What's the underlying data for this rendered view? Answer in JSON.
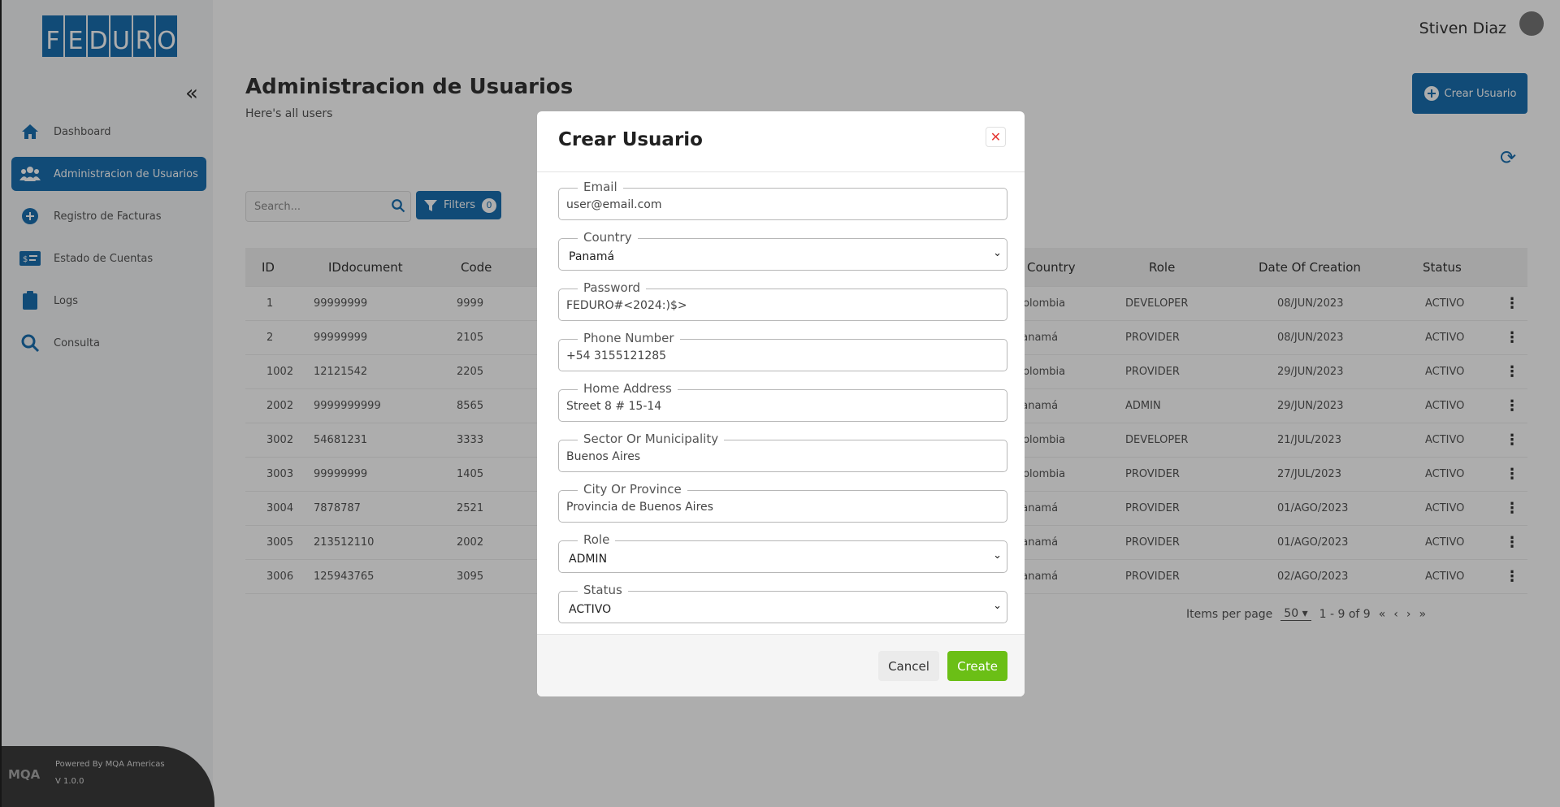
{
  "logo": {
    "letters": [
      "F",
      "E",
      "D",
      "U",
      "R",
      "O"
    ]
  },
  "sidebar": {
    "collapse_icon": "double-chevron-left",
    "items": [
      {
        "label": "Dashboard",
        "icon": "home"
      },
      {
        "label": "Administracion de Usuarios",
        "icon": "users"
      },
      {
        "label": "Registro de Facturas",
        "icon": "plus-circle"
      },
      {
        "label": "Estado de Cuentas",
        "icon": "id-card"
      },
      {
        "label": "Logs",
        "icon": "clipboard"
      },
      {
        "label": "Consulta",
        "icon": "search"
      }
    ],
    "footer": {
      "logo": "MQA",
      "powered": "Powered By MQA Americas",
      "version": "V 1.0.0"
    }
  },
  "header": {
    "user_name": "Stiven Diaz"
  },
  "main": {
    "title": "Administracion de Usuarios",
    "subtitle": "Here's all users",
    "create_button": "Crear Usuario",
    "search_placeholder": "Search...",
    "filters_label": "Filters",
    "filters_count": "0"
  },
  "table": {
    "columns": [
      "ID",
      "IDdocument",
      "Code",
      "Country",
      "Role",
      "Date Of Creation",
      "Status"
    ],
    "rows": [
      {
        "id": "1",
        "iddocument": "99999999",
        "code": "9999",
        "country": "Colombia",
        "role": "DEVELOPER",
        "date": "08/JUN/2023",
        "status": "ACTIVO"
      },
      {
        "id": "2",
        "iddocument": "99999999",
        "code": "2105",
        "country": "Panamá",
        "role": "PROVIDER",
        "date": "08/JUN/2023",
        "status": "ACTIVO"
      },
      {
        "id": "1002",
        "iddocument": "12121542",
        "code": "2205",
        "country": "Colombia",
        "role": "PROVIDER",
        "date": "29/JUN/2023",
        "status": "ACTIVO"
      },
      {
        "id": "2002",
        "iddocument": "9999999999",
        "code": "8565",
        "country": "Panamá",
        "role": "ADMIN",
        "date": "29/JUN/2023",
        "status": "ACTIVO"
      },
      {
        "id": "3002",
        "iddocument": "54681231",
        "code": "3333",
        "country": "Colombia",
        "role": "DEVELOPER",
        "date": "21/JUL/2023",
        "status": "ACTIVO"
      },
      {
        "id": "3003",
        "iddocument": "99999999",
        "code": "1405",
        "country": "Colombia",
        "role": "PROVIDER",
        "date": "27/JUL/2023",
        "status": "ACTIVO"
      },
      {
        "id": "3004",
        "iddocument": "7878787",
        "code": "2521",
        "country": "Panamá",
        "role": "PROVIDER",
        "date": "01/AGO/2023",
        "status": "ACTIVO"
      },
      {
        "id": "3005",
        "iddocument": "213512110",
        "code": "2002",
        "country": "Panamá",
        "role": "PROVIDER",
        "date": "01/AGO/2023",
        "status": "ACTIVO"
      },
      {
        "id": "3006",
        "iddocument": "125943765",
        "code": "3095",
        "country": "Panamá",
        "role": "PROVIDER",
        "date": "02/AGO/2023",
        "status": "ACTIVO"
      }
    ],
    "pagination": {
      "items_per_page_label": "Items per page",
      "items_per_page": "50",
      "range": "1 - 9 of 9"
    }
  },
  "modal": {
    "title": "Crear Usuario",
    "fields": [
      {
        "label": "Email",
        "value": "user@email.com",
        "type": "text"
      },
      {
        "label": "Country",
        "value": "Panamá",
        "type": "select"
      },
      {
        "label": "Password",
        "value": "FEDURO#<2024:)$>",
        "type": "text"
      },
      {
        "label": "Phone Number",
        "value": "+54 3155121285",
        "type": "text"
      },
      {
        "label": "Home Address",
        "value": "Street 8 # 15-14",
        "type": "text"
      },
      {
        "label": "Sector Or Municipality",
        "value": "Buenos Aires",
        "type": "text"
      },
      {
        "label": "City Or Province",
        "value": "Provincia de Buenos Aires",
        "type": "text"
      },
      {
        "label": "Role",
        "value": "ADMIN",
        "type": "select"
      },
      {
        "label": "Status",
        "value": "ACTIVO",
        "type": "select"
      }
    ],
    "cancel_label": "Cancel",
    "create_label": "Create"
  },
  "colors": {
    "primary": "#1a6fb0",
    "create_green": "#6bbf16",
    "close_red": "#e53935"
  }
}
